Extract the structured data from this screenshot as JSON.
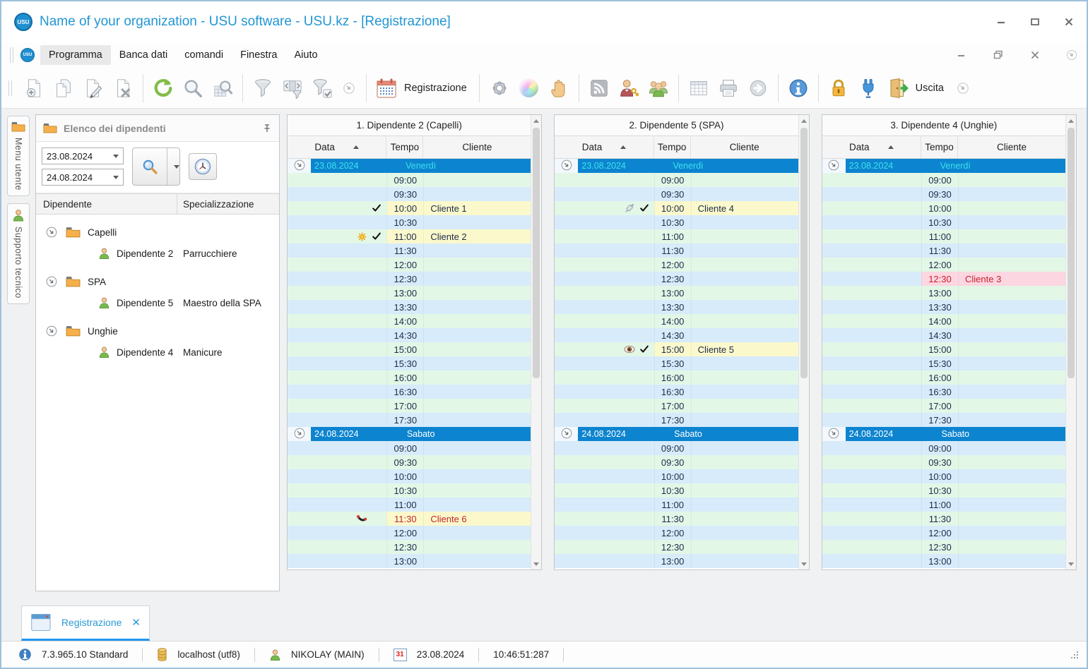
{
  "window": {
    "title": "Name of your organization - USU software - USU.kz - [Registrazione]",
    "logo_text": "USU"
  },
  "menu": {
    "items": [
      "Programma",
      "Banca dati",
      "comandi",
      "Finestra",
      "Aiuto"
    ],
    "active_index": 0
  },
  "toolbar": {
    "registration_label": "Registrazione",
    "exit_label": "Uscita",
    "icon_names": [
      "add-record-icon",
      "copy-record-icon",
      "edit-record-icon",
      "delete-record-icon",
      "refresh-icon",
      "search-icon",
      "search-in-list-icon",
      "filter-icon",
      "filter-range-icon",
      "filter-apply-icon",
      "more-icon",
      "registration-calendar-icon",
      "settings-gear-icon",
      "appearance-sphere-icon",
      "stop-hand-icon",
      "news-feed-icon",
      "user-access-icon",
      "employees-icon",
      "table-icon",
      "print-icon",
      "go-arrow-icon",
      "info-icon",
      "lock-icon",
      "connection-plug-icon",
      "exit-door-icon",
      "more-icon"
    ]
  },
  "sidebar": {
    "tabs": [
      {
        "label": "Menu utente",
        "icon": "folder-icon"
      },
      {
        "label": "Supporto tecnico",
        "icon": "person-icon"
      }
    ]
  },
  "employees_panel": {
    "title": "Elenco dei dipendenti",
    "date_from": "23.08.2024",
    "date_to": "24.08.2024",
    "columns": [
      "Dipendente",
      "Specializzazione"
    ],
    "groups": [
      {
        "name": "Capelli",
        "employees": [
          {
            "name": "Dipendente 2",
            "specialization": "Parrucchiere"
          }
        ]
      },
      {
        "name": "SPA",
        "employees": [
          {
            "name": "Dipendente 5",
            "specialization": "Maestro della SPA"
          }
        ]
      },
      {
        "name": "Unghie",
        "employees": [
          {
            "name": "Dipendente 4",
            "specialization": "Manicure"
          }
        ]
      }
    ]
  },
  "schedule": {
    "columns": [
      "Data",
      "Tempo",
      "Cliente"
    ],
    "days": [
      {
        "date": "23.08.2024",
        "weekday": "Venerdì",
        "text_color": "#3be2ec",
        "times": [
          "09:00",
          "09:30",
          "10:00",
          "10:30",
          "11:00",
          "11:30",
          "12:00",
          "12:30",
          "13:00",
          "13:30",
          "14:00",
          "14:30",
          "15:00",
          "15:30",
          "16:00",
          "16:30",
          "17:00",
          "17:30"
        ]
      },
      {
        "date": "24.08.2024",
        "weekday": "Sabato",
        "text_color": "#ffffff",
        "times": [
          "09:00",
          "09:30",
          "10:00",
          "10:30",
          "11:00",
          "11:30",
          "12:00",
          "12:30",
          "13:00"
        ]
      }
    ],
    "panels": [
      {
        "title": "1. Dipendente 2 (Capelli)",
        "appointments": [
          {
            "day": 0,
            "time": "10:00",
            "client": "Cliente 1",
            "icons": [
              "check"
            ],
            "highlight": "yellow",
            "text": "dark"
          },
          {
            "day": 0,
            "time": "11:00",
            "client": "Cliente 2",
            "icons": [
              "star",
              "check"
            ],
            "highlight": "yellow",
            "text": "dark"
          },
          {
            "day": 1,
            "time": "11:30",
            "client": "Cliente 6",
            "icons": [
              "phone"
            ],
            "highlight": "yellow",
            "text": "red"
          }
        ]
      },
      {
        "title": "2. Dipendente 5 (SPA)",
        "appointments": [
          {
            "day": 0,
            "time": "10:00",
            "client": "Cliente 4",
            "icons": [
              "syringe",
              "check"
            ],
            "highlight": "yellow",
            "text": "dark"
          },
          {
            "day": 0,
            "time": "15:00",
            "client": "Cliente 5",
            "icons": [
              "eye",
              "check"
            ],
            "highlight": "yellow",
            "text": "dark"
          }
        ]
      },
      {
        "title": "3. Dipendente 4 (Unghie)",
        "appointments": [
          {
            "day": 0,
            "time": "12:30",
            "client": "Cliente 3",
            "icons": [],
            "highlight": "pink",
            "text": "red"
          }
        ]
      }
    ]
  },
  "bottom_tab": {
    "label": "Registrazione"
  },
  "status_bar": {
    "version": "7.3.965.10 Standard",
    "database": "localhost (utf8)",
    "user": "NIKOLAY (MAIN)",
    "calendar_day": "31",
    "date": "23.08.2024",
    "time": "10:46:51:287"
  },
  "colors": {
    "accent_blue": "#2196d3",
    "band_blue": "#0d84cf",
    "row_green": "#e3f7e7",
    "row_blue": "#d7ebfb",
    "appointment_yellow": "#fbf9cc",
    "appointment_pink": "#fcd6e1",
    "alert_red": "#c4242e",
    "friday_text": "#3be2ec",
    "saturday_text": "#ffffff"
  }
}
